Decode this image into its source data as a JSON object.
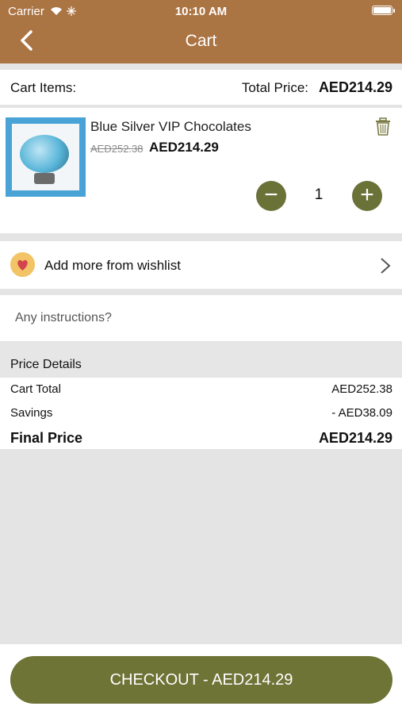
{
  "status_bar": {
    "carrier": "Carrier",
    "time": "10:10 AM"
  },
  "nav": {
    "title": "Cart",
    "back_icon": "chevron-left-icon"
  },
  "summary": {
    "label": "Cart Items:",
    "total_label": "Total Price:",
    "total_value": "AED214.29"
  },
  "item": {
    "name": "Blue Silver VIP Chocolates",
    "old_price": "AED252.38",
    "price": "AED214.29",
    "quantity": "1",
    "minus": "−",
    "plus": "+"
  },
  "wishlist": {
    "label": "Add more from wishlist"
  },
  "instructions": {
    "placeholder": "Any instructions?"
  },
  "price_details": {
    "title": "Price Details",
    "cart_total_label": "Cart Total",
    "cart_total_value": "AED252.38",
    "savings_label": "Savings",
    "savings_value": "- AED38.09",
    "final_label": "Final Price",
    "final_value": "AED214.29"
  },
  "checkout": {
    "label": "CHECKOUT - AED214.29"
  },
  "colors": {
    "header": "#ab7443",
    "accent": "#6e7336",
    "background": "#e4e4e4"
  }
}
